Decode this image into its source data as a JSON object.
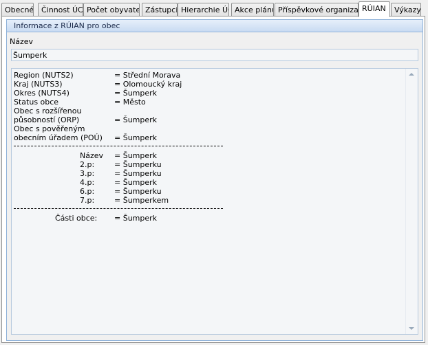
{
  "tabs": [
    {
      "label": "Obecné"
    },
    {
      "label": "Činnost ÚC"
    },
    {
      "label": "Počet obyvatel"
    },
    {
      "label": "Zástupci"
    },
    {
      "label": "Hierarchie ÚC"
    },
    {
      "label": "Akce plánu"
    },
    {
      "label": "Příspěvkové organizace"
    },
    {
      "label": "RÚIAN"
    },
    {
      "label": "Výkazy"
    }
  ],
  "group": {
    "title": "Informace z RÚIAN pro obec",
    "name_label": "Název",
    "name_value": "Šumperk"
  },
  "info": {
    "regions": [
      {
        "label": "Region (NUTS2)",
        "value": "= Střední Morava"
      },
      {
        "label": "Kraj (NUTS3)",
        "value": "= Olomoucký kraj"
      },
      {
        "label": "Okres (NUTS4)",
        "value": "= Šumperk"
      },
      {
        "label": "Status obce",
        "value": "= Město"
      }
    ],
    "orp_label_1": "Obec s rozšířenou",
    "orp_label_2": "působností (ORP)",
    "orp_value": "= Šumperk",
    "pou_label_1": "Obec s pověřeným",
    "pou_label_2": "obecním úřadem (POÚ)",
    "pou_value": "= Šumperk",
    "separator": "--------------------------------------------------------------",
    "cases": [
      {
        "label": "Název",
        "value": "= Šumperk"
      },
      {
        "label": "2.p:",
        "value": "= Šumperku"
      },
      {
        "label": "3.p:",
        "value": "= Šumperku"
      },
      {
        "label": "4.p:",
        "value": "= Šumperk"
      },
      {
        "label": "6.p:",
        "value": "= Šumperku"
      },
      {
        "label": "7.p:",
        "value": "= Šumperkem"
      }
    ],
    "parts_label": "Části obce:",
    "parts_value": "= Šumperk"
  }
}
